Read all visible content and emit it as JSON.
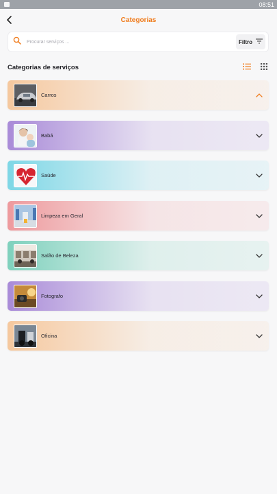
{
  "status": {
    "time": "08:51"
  },
  "header": {
    "title": "Categorias"
  },
  "search": {
    "placeholder": "Procurar serviços ...",
    "filter_label": "Filtro"
  },
  "section": {
    "title": "Categorias de serviços"
  },
  "categories": [
    {
      "label": "Carros",
      "expanded": true,
      "color": "#f5c89e"
    },
    {
      "label": "Babá",
      "expanded": false,
      "color": "#a98bd8"
    },
    {
      "label": "Saúde",
      "expanded": false,
      "color": "#7ed7e6"
    },
    {
      "label": "Limpeza em Geral",
      "expanded": false,
      "color": "#ee9a9d"
    },
    {
      "label": "Salão de Beleza",
      "expanded": false,
      "color": "#7fd1bd"
    },
    {
      "label": "Fotografo",
      "expanded": false,
      "color": "#a98bd8"
    },
    {
      "label": "Oficina",
      "expanded": false,
      "color": "#f5c89e"
    }
  ],
  "colors": {
    "accent": "#f07c1d"
  }
}
